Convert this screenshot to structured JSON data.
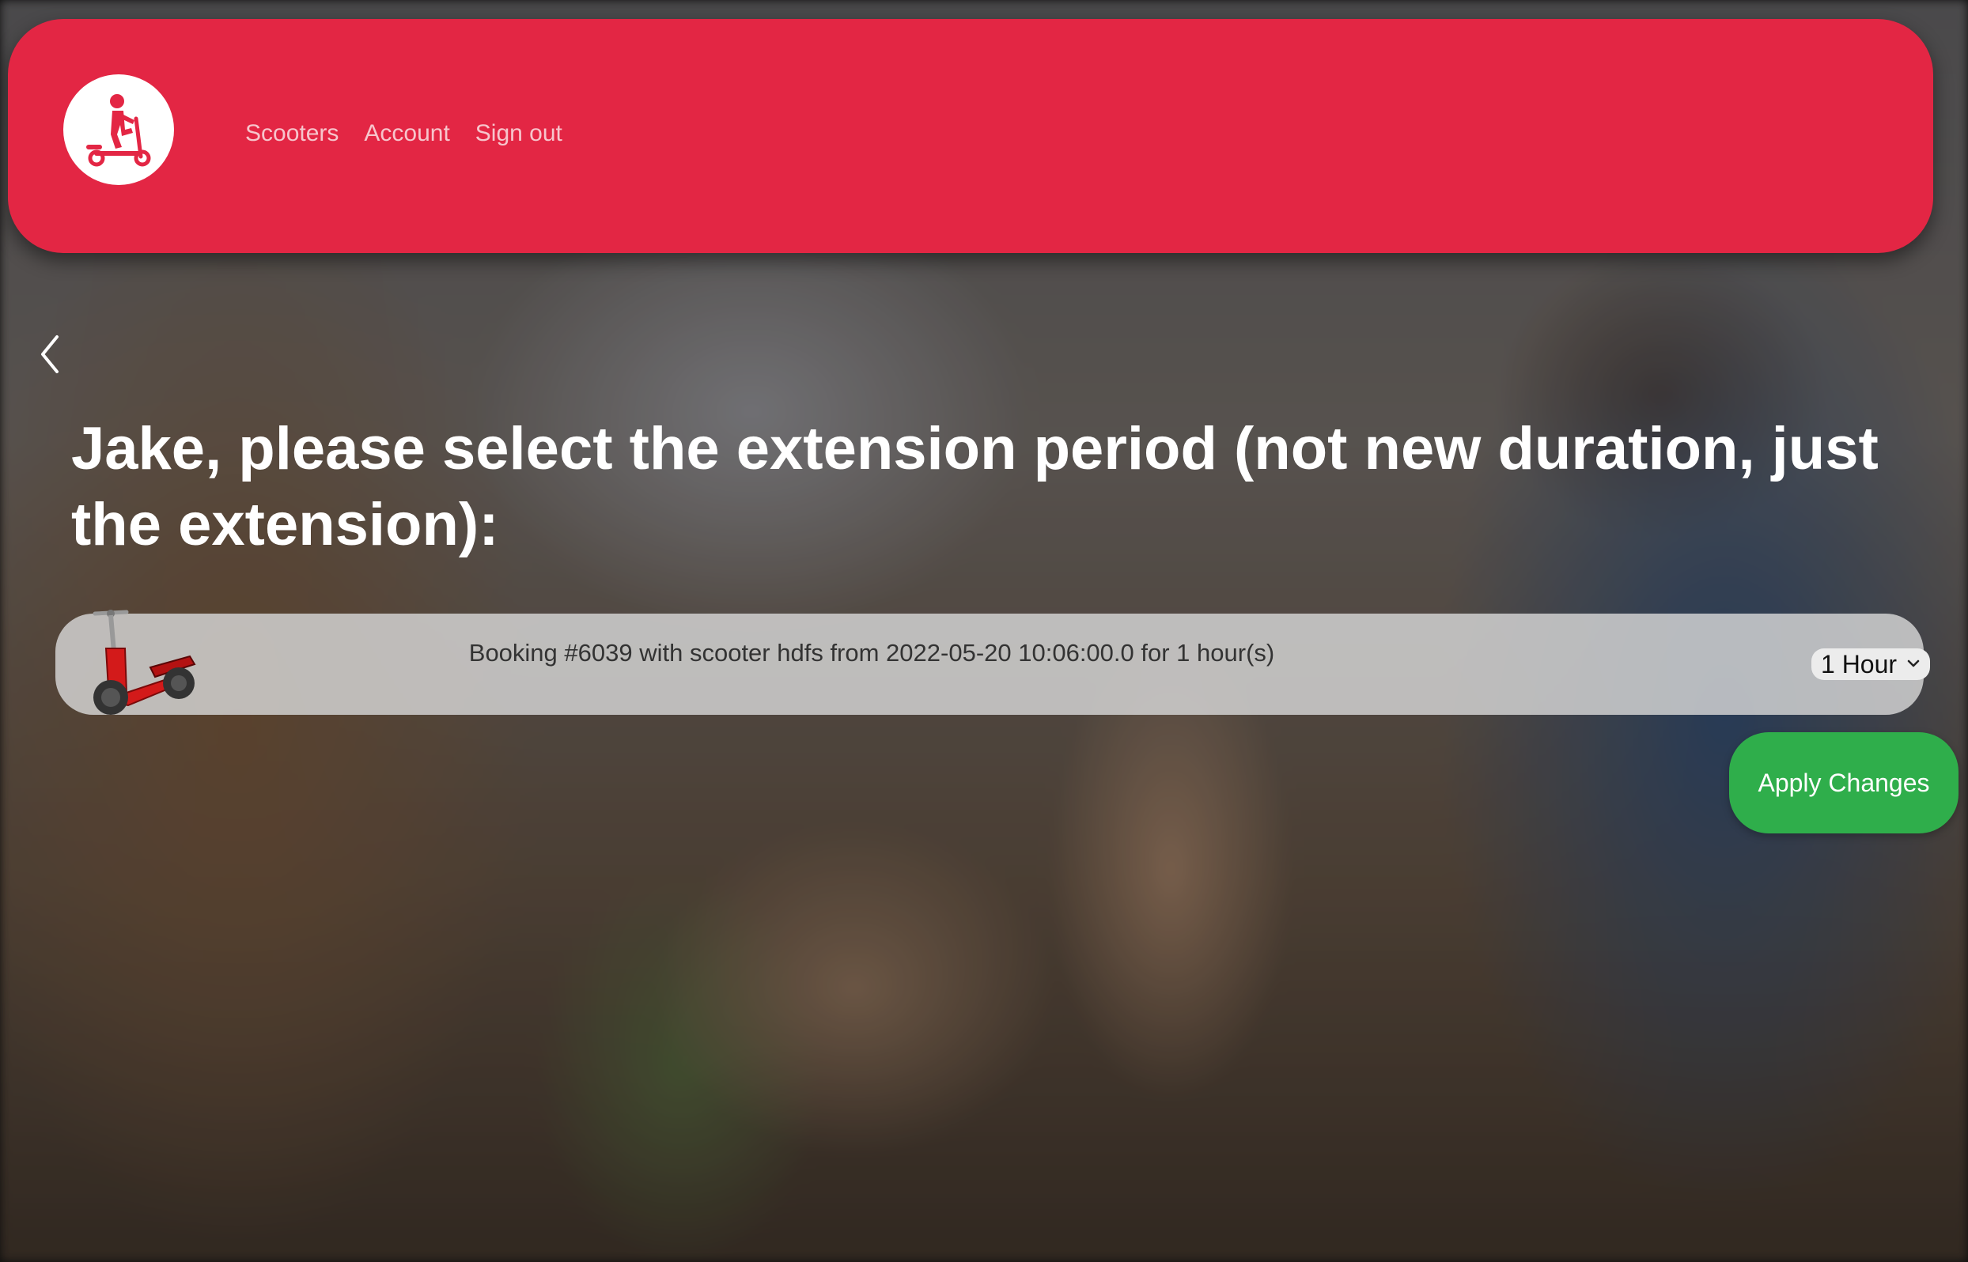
{
  "header": {
    "logo_icon": "scooter-rider-logo-icon",
    "brand_color": "#e32644",
    "nav": [
      {
        "label": "Scooters"
      },
      {
        "label": "Account"
      },
      {
        "label": "Sign out"
      }
    ]
  },
  "page": {
    "back_icon": "chevron-left-icon",
    "heading": "Jake, please select the extension period (not new duration, just the extension):"
  },
  "booking": {
    "thumbnail_icon": "red-scooter-icon",
    "description": "Booking #6039 with scooter hdfs from 2022-05-20 10:06:00.0 for 1 hour(s)",
    "extension_select": {
      "selected": "1 Hour"
    }
  },
  "actions": {
    "apply_label": "Apply Changes",
    "apply_color": "#2fae4b"
  }
}
